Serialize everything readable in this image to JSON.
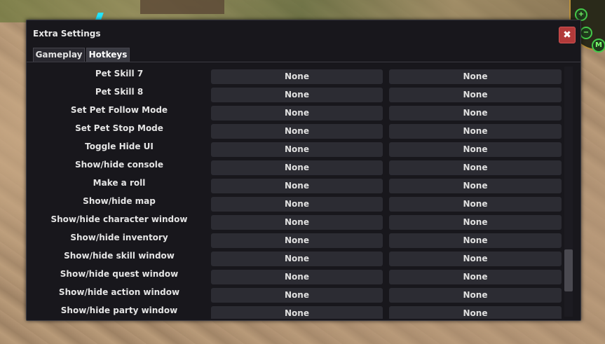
{
  "dialog": {
    "title": "Extra Settings",
    "close_icon": "✖"
  },
  "tabs": [
    {
      "label": "Gameplay",
      "active": false
    },
    {
      "label": "Hotkeys",
      "active": true
    }
  ],
  "hotkeys": [
    {
      "action": "Pet Skill 7",
      "primary": "None",
      "secondary": "None"
    },
    {
      "action": "Pet Skill 8",
      "primary": "None",
      "secondary": "None"
    },
    {
      "action": "Set Pet Follow Mode",
      "primary": "None",
      "secondary": "None"
    },
    {
      "action": "Set Pet Stop Mode",
      "primary": "None",
      "secondary": "None"
    },
    {
      "action": "Toggle Hide UI",
      "primary": "None",
      "secondary": "None"
    },
    {
      "action": "Show/hide console",
      "primary": "None",
      "secondary": "None"
    },
    {
      "action": "Make a roll",
      "primary": "None",
      "secondary": "None"
    },
    {
      "action": "Show/hide map",
      "primary": "None",
      "secondary": "None"
    },
    {
      "action": "Show/hide character window",
      "primary": "None",
      "secondary": "None"
    },
    {
      "action": "Show/hide inventory",
      "primary": "None",
      "secondary": "None"
    },
    {
      "action": "Show/hide skill window",
      "primary": "None",
      "secondary": "None"
    },
    {
      "action": "Show/hide quest window",
      "primary": "None",
      "secondary": "None"
    },
    {
      "action": "Show/hide action window",
      "primary": "None",
      "secondary": "None"
    },
    {
      "action": "Show/hide party window",
      "primary": "None",
      "secondary": "None"
    }
  ],
  "minimap": {
    "buttons": [
      {
        "icon": "zoom-in-icon",
        "glyph": "+"
      },
      {
        "icon": "zoom-out-icon",
        "glyph": "−"
      },
      {
        "icon": "map-m-icon",
        "glyph": "M"
      }
    ]
  }
}
